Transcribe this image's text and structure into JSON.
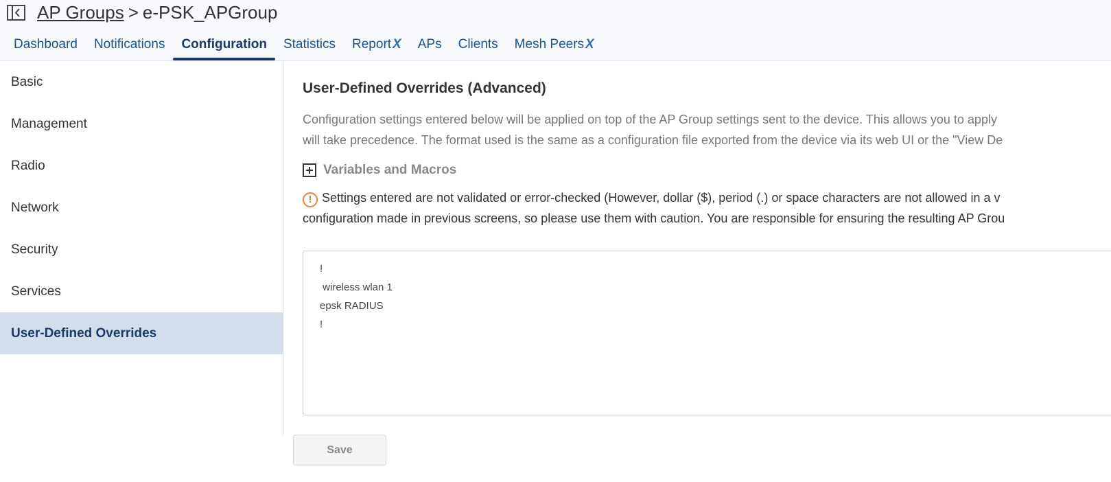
{
  "header": {
    "breadcrumb_parent": "AP Groups",
    "breadcrumb_separator": ">",
    "breadcrumb_current": "e-PSK_APGroup",
    "collapse_icon": "sidebar-collapse-icon"
  },
  "tabs": [
    {
      "label": "Dashboard",
      "active": false
    },
    {
      "label": "Notifications",
      "active": false
    },
    {
      "label": "Configuration",
      "active": true
    },
    {
      "label": "Statistics",
      "active": false
    },
    {
      "label": "Report",
      "badge": "X",
      "active": false
    },
    {
      "label": "APs",
      "active": false
    },
    {
      "label": "Clients",
      "active": false
    },
    {
      "label": "Mesh Peers",
      "badge": "X",
      "active": false
    }
  ],
  "sidebar": {
    "items": [
      {
        "label": "Basic"
      },
      {
        "label": "Management"
      },
      {
        "label": "Radio"
      },
      {
        "label": "Network"
      },
      {
        "label": "Security"
      },
      {
        "label": "Services"
      },
      {
        "label": "User-Defined Overrides",
        "active": true
      }
    ]
  },
  "main": {
    "title": "User-Defined Overrides (Advanced)",
    "description_line1": "Configuration settings entered below will be applied on top of the AP Group settings sent to the device. This allows you to apply",
    "description_line2": "will take precedence. The format used is the same as a configuration file exported from the device via its web UI or the \"View De",
    "variables_label": "Variables and Macros",
    "warning_line1": "Settings entered are not validated or error-checked (However, dollar ($), period (.) or space characters are not allowed in a v",
    "warning_line2": "configuration made in previous screens, so please use them with caution. You are responsible for ensuring the resulting AP Grou",
    "editor_lines": [
      "!",
      " wireless wlan 1",
      "epsk RADIUS",
      "!"
    ],
    "save_label": "Save"
  },
  "colors": {
    "accent": "#1b3a66",
    "tab_text": "#1e4f8a",
    "sidebar_active_bg": "#d3deed",
    "warning": "#e8833a"
  }
}
